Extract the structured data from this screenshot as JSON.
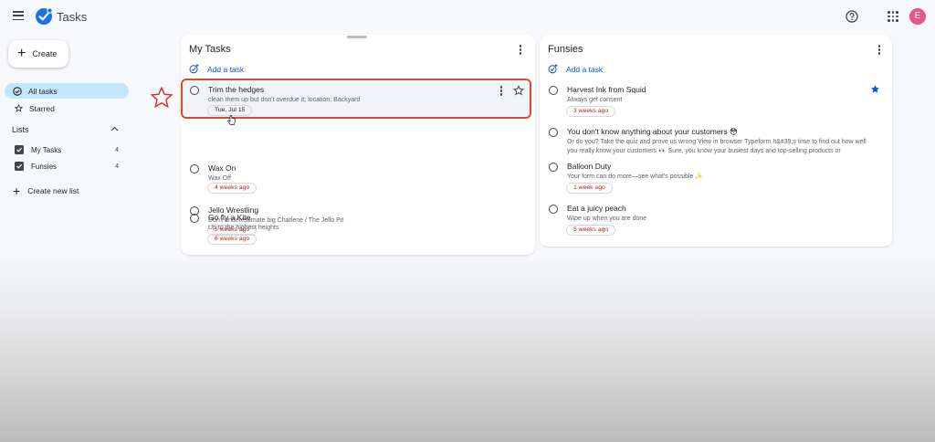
{
  "app": {
    "title": "Tasks",
    "avatar_letter": "E",
    "accent": "#0b57d0",
    "brand_blue": "#1a73e8"
  },
  "icons": {
    "menu": "menu-icon",
    "help": "help-icon",
    "apps": "apps-grid-icon",
    "add_task": "add-task-icon",
    "star": "star-icon"
  },
  "sidebar": {
    "create_label": "Create",
    "all_tasks": "All tasks",
    "starred": "Starred",
    "lists_heading": "Lists",
    "lists": [
      {
        "name": "My Tasks",
        "count": "4"
      },
      {
        "name": "Funsies",
        "count": "4"
      }
    ],
    "create_new_list": "Create new list"
  },
  "lists": [
    {
      "title": "My Tasks",
      "add_task_label": "Add a task",
      "tasks": [
        {
          "title": "Trim the hedges",
          "notes": "clean them up but don't overdue it; location: Backyard",
          "chip": "Tue, Jul 15"
        },
        {
          "title": "Wax On",
          "notes": "Wax Off",
          "chip": "4 weeks ago"
        },
        {
          "title": "Jello Wrestling",
          "notes": "Don't underestimate big Charlene / The Jello Pit",
          "chip": "5 weeks ago"
        },
        {
          "title": "Go fly a Kite",
          "notes": "Up to the highest heights",
          "chip": "6 weeks ago"
        }
      ]
    },
    {
      "title": "Funsies",
      "add_task_label": "Add a task",
      "tasks": [
        {
          "title": "Harvest Ink from Squid",
          "notes": "Always get consent",
          "chip": "3 weeks ago",
          "starred": true
        },
        {
          "title": "You don't know anything about your customers 😳",
          "notes": "Or do you? Take the quiz and prove us wrong View in browser Typeform It&#39;s time to find out how well you really know your customers 👀 Sure, you know your busiest days and top-selling products or"
        },
        {
          "title": "Balloon Duty",
          "notes": "Your form can do more—see what's possible ✨",
          "chip": "1 week ago"
        },
        {
          "title": "Eat a juicy peach",
          "notes": "Wipe up when you are done",
          "chip": "5 weeks ago"
        }
      ]
    }
  ],
  "colors": {
    "highlight_border": "#dc4b2c",
    "selected_nav": "#c2e7ff",
    "overdue_chip_text": "#b3261e",
    "avatar_bg": "#e8548c"
  }
}
